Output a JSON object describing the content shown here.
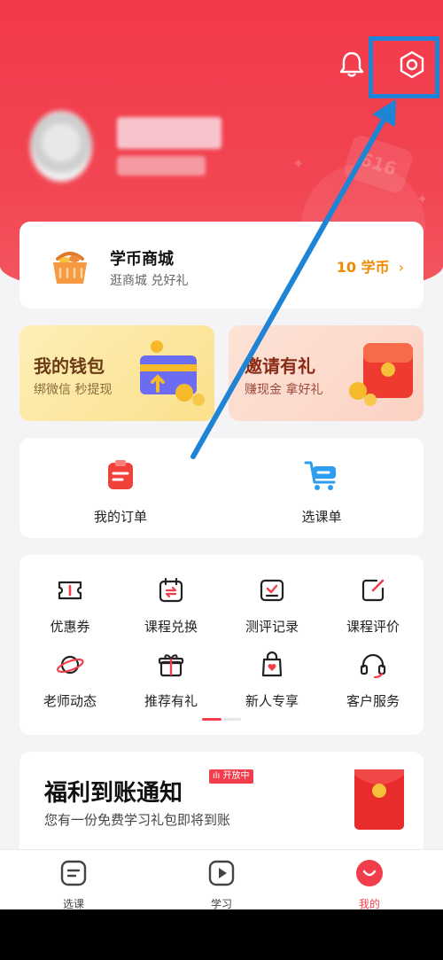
{
  "mall": {
    "title": "学币商城",
    "subtitle": "逛商城 兑好礼",
    "coins": "10 学币",
    "chevron": "›"
  },
  "promos": {
    "wallet": {
      "title": "我的钱包",
      "subtitle": "绑微信 秒提现"
    },
    "invite": {
      "title": "邀请有礼",
      "subtitle": "赚现金 拿好礼"
    }
  },
  "orders": [
    {
      "label": "我的订单",
      "icon": "order-icon"
    },
    {
      "label": "选课单",
      "icon": "cart-icon"
    }
  ],
  "grid": [
    {
      "label": "优惠券",
      "icon": "coupon-icon"
    },
    {
      "label": "课程兑换",
      "icon": "exchange-icon"
    },
    {
      "label": "测评记录",
      "icon": "assessment-icon"
    },
    {
      "label": "课程评价",
      "icon": "review-icon"
    },
    {
      "label": "老师动态",
      "icon": "planet-icon"
    },
    {
      "label": "推荐有礼",
      "icon": "gift-icon"
    },
    {
      "label": "新人专享",
      "icon": "newbie-bag-icon"
    },
    {
      "label": "客户服务",
      "icon": "headset-icon"
    }
  ],
  "notice": {
    "title": "福利到账通知",
    "badge": "开放中",
    "subtitle": "您有一份免费学习礼包即将到账"
  },
  "tabs": [
    {
      "label": "选课",
      "icon": "course-select-icon",
      "active": false
    },
    {
      "label": "学习",
      "icon": "play-icon",
      "active": false
    },
    {
      "label": "我的",
      "icon": "profile-icon",
      "active": true
    }
  ],
  "colors": {
    "brand": "#f23e4c",
    "annotation": "#1f84d4",
    "coin": "#f08a00"
  },
  "hero_deco_text": "616"
}
